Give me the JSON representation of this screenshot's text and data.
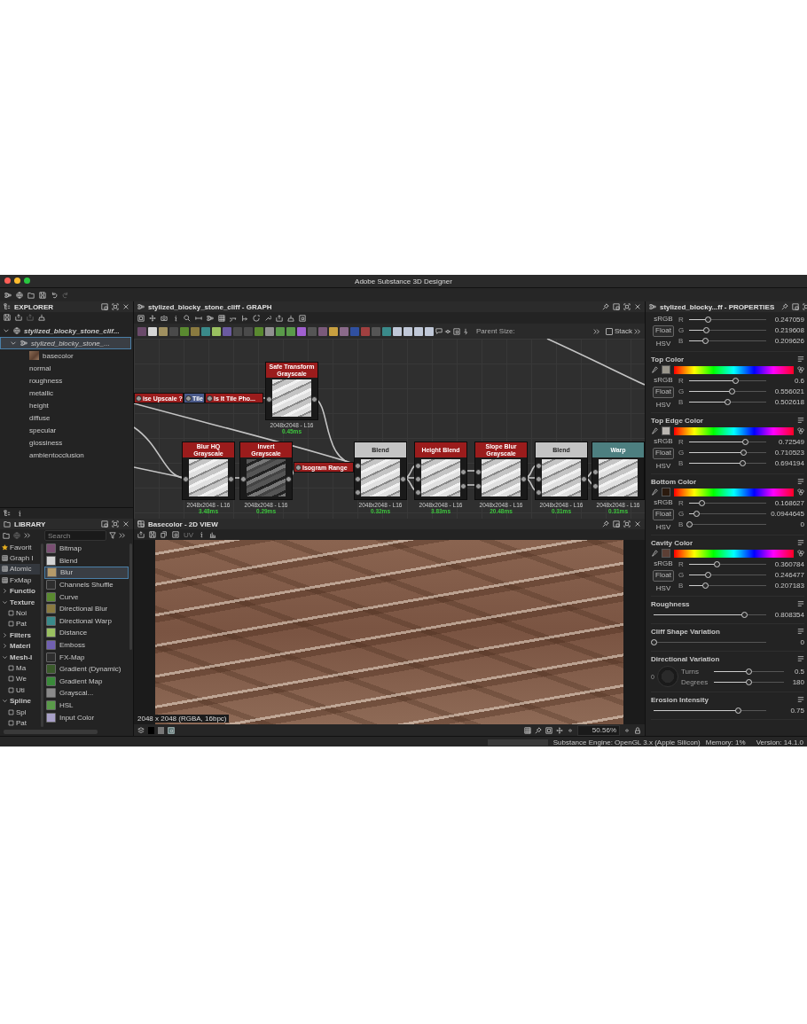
{
  "window": {
    "title": "Adobe Substance 3D Designer"
  },
  "explorer": {
    "title": "EXPLORER",
    "tree": [
      {
        "label": "stylized_blocky_stone_clif...",
        "expanded": true,
        "selected": false,
        "children": [
          {
            "label": "stylized_blocky_stone_...",
            "expanded": true,
            "selected": true,
            "children": [
              {
                "label": "basecolor",
                "kind": "preview",
                "selected": false
              },
              {
                "label": "normal",
                "kind": "plain",
                "selected": false
              },
              {
                "label": "roughness",
                "kind": "plain",
                "selected": false
              },
              {
                "label": "metallic",
                "kind": "plain",
                "selected": false
              },
              {
                "label": "height",
                "kind": "plain",
                "selected": false
              },
              {
                "label": "diffuse",
                "kind": "plain",
                "selected": false
              },
              {
                "label": "specular",
                "kind": "plain",
                "selected": false
              },
              {
                "label": "glossiness",
                "kind": "plain",
                "selected": false
              },
              {
                "label": "ambientocclusion",
                "kind": "plain",
                "selected": false
              }
            ]
          }
        ]
      }
    ]
  },
  "library": {
    "title": "LIBRARY",
    "search": {
      "placeholder": "Search"
    },
    "categories": [
      {
        "label": "Favorit",
        "kind": "star",
        "selected": false
      },
      {
        "label": "Graph I",
        "kind": "item",
        "selected": false
      },
      {
        "label": "Atomic",
        "kind": "item",
        "selected": true
      },
      {
        "label": "FxMap",
        "kind": "item",
        "selected": false
      },
      {
        "label": "Functio",
        "kind": "group",
        "expanded": false,
        "selected": false
      },
      {
        "label": "Texture",
        "kind": "group",
        "expanded": true,
        "selected": false,
        "children": [
          {
            "label": "Noi",
            "selected": false
          },
          {
            "label": "Pat",
            "selected": false
          }
        ]
      },
      {
        "label": "Filters",
        "kind": "group",
        "expanded": false,
        "selected": false
      },
      {
        "label": "Materi",
        "kind": "group",
        "expanded": false,
        "selected": false
      },
      {
        "label": "Mesh-I",
        "kind": "group",
        "expanded": true,
        "selected": false,
        "children": [
          {
            "label": "Ma",
            "selected": false
          },
          {
            "label": "We",
            "selected": false
          },
          {
            "label": "Uti",
            "selected": false
          }
        ]
      },
      {
        "label": "Spline",
        "kind": "group",
        "expanded": true,
        "selected": false,
        "children": [
          {
            "label": "Spl",
            "selected": false
          },
          {
            "label": "Pat",
            "selected": false
          }
        ]
      }
    ],
    "items": [
      {
        "label": "Bitmap",
        "color": "#7a4f72",
        "selected": false
      },
      {
        "label": "Blend",
        "color": "#d4d4d4",
        "selected": false
      },
      {
        "label": "Blur",
        "color": "#b49a6a",
        "selected": true
      },
      {
        "label": "Channels Shuffle",
        "color": "#2e2e2e",
        "selected": false
      },
      {
        "label": "Curve",
        "color": "#5a8a30",
        "selected": false
      },
      {
        "label": "Directional Blur",
        "color": "#8a7a40",
        "selected": false
      },
      {
        "label": "Directional Warp",
        "color": "#3a8a8a",
        "selected": false
      },
      {
        "label": "Distance",
        "color": "#9ac060",
        "selected": false
      },
      {
        "label": "Emboss",
        "color": "#7060b0",
        "selected": false
      },
      {
        "label": "FX-Map",
        "color": "#2e2e2e",
        "selected": false
      },
      {
        "label": "Gradient (Dynamic)",
        "color": "#3a5a2a",
        "selected": false
      },
      {
        "label": "Gradient Map",
        "color": "#3a8a3a",
        "selected": false
      },
      {
        "label": "Grayscal...",
        "color": "#8a8a8a",
        "selected": false
      },
      {
        "label": "HSL",
        "color": "#5a9a4a",
        "selected": false
      },
      {
        "label": "Input Color",
        "color": "#a8a0c8",
        "selected": false
      }
    ]
  },
  "graph": {
    "title": "stylized_blocky_stone_cliff - GRAPH",
    "parent_size": "Parent Size:",
    "stack": {
      "label": "Stack",
      "checked": false
    },
    "nodes": [
      {
        "kind": "pill",
        "title": "ise Upscale ?",
        "color": "#9b1c1c"
      },
      {
        "kind": "pill",
        "title": "Tile",
        "color": "#4a5a8a"
      },
      {
        "kind": "pill",
        "title": "ls It Tile Pho...",
        "color": "#9b1c1c"
      },
      {
        "kind": "node",
        "title": "Safe Transform Grayscale",
        "color": "#9b1c1c",
        "resolution": "2048x2048 - L16",
        "time": "0.45ms"
      },
      {
        "kind": "node",
        "title": "Blur HQ Grayscale",
        "color": "#9b1c1c",
        "resolution": "2048x2048 - L16",
        "time": "3.48ms"
      },
      {
        "kind": "node",
        "title": "Invert Grayscale",
        "color": "#9b1c1c",
        "resolution": "2048x2048 - L16",
        "time": "0.29ms"
      },
      {
        "kind": "pill",
        "title": "Isogram Range",
        "color": "#9b1c1c"
      },
      {
        "kind": "node",
        "title": "Blend",
        "color": "#c4c4c4",
        "resolution": "2048x2048 - L16",
        "time": "0.32ms"
      },
      {
        "kind": "node",
        "title": "Height Blend",
        "color": "#9b1c1c",
        "resolution": "2048x2048 - L16",
        "time": "3.83ms"
      },
      {
        "kind": "node",
        "title": "Slope Blur Grayscale",
        "color": "#9b1c1c",
        "resolution": "2048x2048 - L16",
        "time": "20.48ms"
      },
      {
        "kind": "node",
        "title": "Blend",
        "color": "#c4c4c4",
        "resolution": "2048x2048 - L16",
        "time": "0.31ms"
      },
      {
        "kind": "node",
        "title": "Warp",
        "color": "#4d7f80",
        "resolution": "2048x2048 - L16",
        "time": "0.31ms"
      }
    ]
  },
  "view": {
    "title": "Basecolor - 2D VIEW",
    "uv": {
      "label": "UV",
      "disabled": true
    },
    "caption": "2048 x 2048 (RGBA, 16bpc)",
    "zoom": "50.56%"
  },
  "properties": {
    "title": "stylized_blocky...ff - PROPERTIES",
    "params": [
      {
        "kind": "color",
        "modes": [
          {
            "label": "sRGB",
            "selected": false
          },
          {
            "label": "Float",
            "selected": true
          },
          {
            "label": "HSV",
            "selected": false
          }
        ],
        "channels": [
          {
            "name": "R",
            "level": 0.247059,
            "reading": "0.247059"
          },
          {
            "name": "G",
            "level": 0.219608,
            "reading": "0.219608"
          },
          {
            "name": "B",
            "level": 0.209626,
            "reading": "0.209626"
          }
        ]
      },
      {
        "kind": "color",
        "label": "Top Color",
        "color": "#9a968c",
        "modes": [
          {
            "label": "sRGB",
            "selected": false
          },
          {
            "label": "Float",
            "selected": true
          },
          {
            "label": "HSV",
            "selected": false
          }
        ],
        "channels": [
          {
            "name": "R",
            "level": 0.6,
            "reading": "0.6"
          },
          {
            "name": "G",
            "level": 0.556021,
            "reading": "0.556021"
          },
          {
            "name": "B",
            "level": 0.502618,
            "reading": "0.502618"
          }
        ]
      },
      {
        "kind": "color",
        "label": "Top Edge Color",
        "color": "#bab6b1",
        "modes": [
          {
            "label": "sRGB",
            "selected": false
          },
          {
            "label": "Float",
            "selected": true
          },
          {
            "label": "HSV",
            "selected": false
          }
        ],
        "channels": [
          {
            "name": "R",
            "level": 0.72549,
            "reading": "0.72549"
          },
          {
            "name": "G",
            "level": 0.710523,
            "reading": "0.710523"
          },
          {
            "name": "B",
            "level": 0.694194,
            "reading": "0.694194"
          }
        ]
      },
      {
        "kind": "color",
        "label": "Bottom Color",
        "color": "#2b1a0e",
        "modes": [
          {
            "label": "sRGB",
            "selected": false
          },
          {
            "label": "Float",
            "selected": true
          },
          {
            "label": "HSV",
            "selected": false
          }
        ],
        "channels": [
          {
            "name": "R",
            "level": 0.168627,
            "reading": "0.168627"
          },
          {
            "name": "G",
            "level": 0.0944645,
            "reading": "0.0944645"
          },
          {
            "name": "B",
            "level": 0,
            "reading": "0"
          }
        ]
      },
      {
        "kind": "color",
        "label": "Cavity Color",
        "color": "#5c3f35",
        "modes": [
          {
            "label": "sRGB",
            "selected": false
          },
          {
            "label": "Float",
            "selected": true
          },
          {
            "label": "HSV",
            "selected": false
          }
        ],
        "channels": [
          {
            "name": "R",
            "level": 0.360784,
            "reading": "0.360784"
          },
          {
            "name": "G",
            "level": 0.246477,
            "reading": "0.246477"
          },
          {
            "name": "B",
            "level": 0.207183,
            "reading": "0.207183"
          }
        ]
      },
      {
        "kind": "slider",
        "label": "Roughness",
        "level": 0.808354,
        "reading": "0.808354"
      },
      {
        "kind": "slider",
        "label": "Cliff Shape Variation",
        "level": 0,
        "reading": "0"
      },
      {
        "kind": "angle",
        "label": "Directional Variation",
        "dial_text": "0",
        "channels": [
          {
            "name": "Turns",
            "level": 0.5,
            "reading": "0.5"
          },
          {
            "name": "Degrees",
            "level": 0.5,
            "reading": "180"
          }
        ]
      },
      {
        "kind": "slider",
        "label": "Erosion Intensity",
        "level": 0.75,
        "reading": "0.75"
      }
    ]
  },
  "status_bar": {
    "engine": "Substance Engine: OpenGL 3.x (Apple Silicon)",
    "memory": "Memory: 1%",
    "version": "Version: 14.1.0"
  }
}
